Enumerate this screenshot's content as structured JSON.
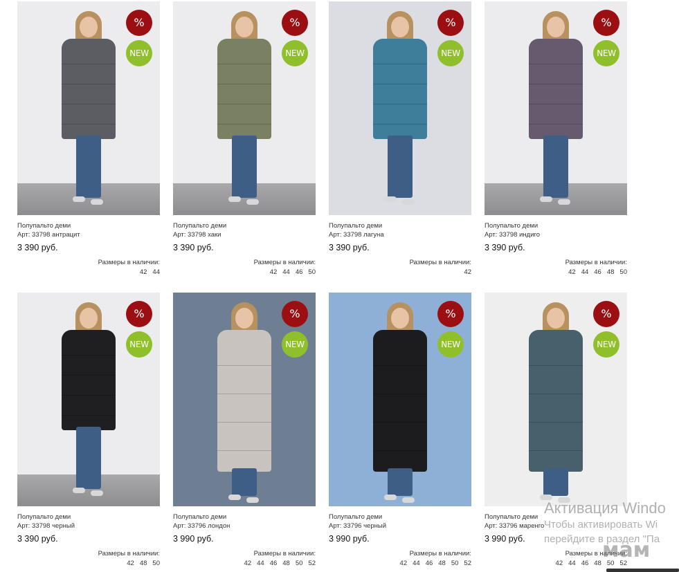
{
  "products": [
    {
      "name": "Полупальто деми",
      "art": "Арт: 33798 антрацит",
      "price": "3 390 руб.",
      "sizes_label": "Размеры в наличии:",
      "sizes": [
        "42",
        "44"
      ],
      "badge_sale": "%",
      "badge_new": "NEW",
      "coat_color": "#5b5d63",
      "bg_color": "#ececee",
      "floor": true
    },
    {
      "name": "Полупальто деми",
      "art": "Арт: 33798 хаки",
      "price": "3 390 руб.",
      "sizes_label": "Размеры в наличии:",
      "sizes": [
        "42",
        "44",
        "46",
        "50"
      ],
      "badge_sale": "%",
      "badge_new": "NEW",
      "coat_color": "#7a8162",
      "bg_color": "#ececee",
      "floor": true
    },
    {
      "name": "Полупальто деми",
      "art": "Арт: 33798 лагуна",
      "price": "3 390 руб.",
      "sizes_label": "Размеры в наличии:",
      "sizes": [
        "42"
      ],
      "badge_sale": "%",
      "badge_new": "NEW",
      "coat_color": "#3f7e9a",
      "bg_color": "#dcdde2",
      "floor": false
    },
    {
      "name": "Полупальто деми",
      "art": "Арт: 33798 индиго",
      "price": "3 390 руб.",
      "sizes_label": "Размеры в наличии:",
      "sizes": [
        "42",
        "44",
        "46",
        "48",
        "50"
      ],
      "badge_sale": "%",
      "badge_new": "NEW",
      "coat_color": "#665a6e",
      "bg_color": "#ececee",
      "floor": true
    },
    {
      "name": "Полупальто деми",
      "art": "Арт: 33798 черный",
      "price": "3 390 руб.",
      "sizes_label": "Размеры в наличии:",
      "sizes": [
        "42",
        "48",
        "50"
      ],
      "badge_sale": "%",
      "badge_new": "NEW",
      "coat_color": "#1f1f22",
      "bg_color": "#ececee",
      "floor": true
    },
    {
      "name": "Полупальто деми",
      "art": "Арт: 33796 лондон",
      "price": "3 990 руб.",
      "sizes_label": "Размеры в наличии:",
      "sizes": [
        "42",
        "44",
        "46",
        "48",
        "50",
        "52"
      ],
      "badge_sale": "%",
      "badge_new": "NEW",
      "coat_color": "#c9c3c0",
      "bg_color": "#6f7f93",
      "floor": false
    },
    {
      "name": "Полупальто деми",
      "art": "Арт: 33796 черный",
      "price": "3 990 руб.",
      "sizes_label": "Размеры в наличии:",
      "sizes": [
        "42",
        "44",
        "46",
        "48",
        "50",
        "52"
      ],
      "badge_sale": "%",
      "badge_new": "NEW",
      "coat_color": "#1c1c1e",
      "bg_color": "#8fb0d6",
      "floor": false
    },
    {
      "name": "Полупальто деми",
      "art": "Арт: 33796 маренго",
      "price": "3 990 руб.",
      "sizes_label": "Размеры в наличии:",
      "sizes": [
        "42",
        "44",
        "46",
        "48",
        "50",
        "52"
      ],
      "badge_sale": "%",
      "badge_new": "NEW",
      "coat_color": "#47606b",
      "bg_color": "#eeeeee",
      "floor": false
    }
  ],
  "watermark": {
    "line1": "Активация Windo",
    "line2": "Чтобы активировать Wi",
    "line3": "перейдите в раздел \"Па",
    "logo": "мам"
  }
}
